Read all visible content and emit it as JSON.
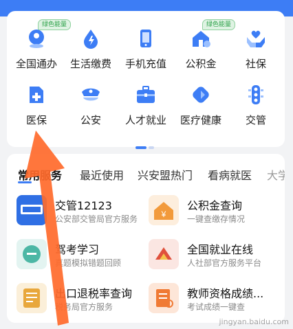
{
  "grid": {
    "items": [
      {
        "label": "全国通办",
        "badge": "绿色能量",
        "icon": "globe-pin-icon"
      },
      {
        "label": "生活缴费",
        "badge": "",
        "icon": "utility-drop-icon"
      },
      {
        "label": "手机充值",
        "badge": "",
        "icon": "phone-icon"
      },
      {
        "label": "公积金",
        "badge": "绿色能量",
        "icon": "fund-house-icon"
      },
      {
        "label": "社保",
        "badge": "",
        "icon": "hands-heart-icon"
      },
      {
        "label": "医保",
        "badge": "",
        "icon": "medical-insurance-icon"
      },
      {
        "label": "公安",
        "badge": "",
        "icon": "police-cap-icon"
      },
      {
        "label": "人才就业",
        "badge": "",
        "icon": "briefcase-icon"
      },
      {
        "label": "医疗健康",
        "badge": "",
        "icon": "heart-health-icon"
      },
      {
        "label": "交管",
        "badge": "",
        "icon": "traffic-light-icon"
      }
    ]
  },
  "tabs": [
    "常用服务",
    "最近使用",
    "兴安盟热门",
    "看病就医",
    "大学"
  ],
  "services": [
    {
      "title": "交管12123",
      "subtitle": "公安部交管局官方服务",
      "icon": "traffic-12123-icon",
      "color": "#2f6fe4"
    },
    {
      "title": "公积金查询",
      "subtitle": "一键查缴存情况",
      "icon": "house-yuan-icon",
      "color": "#f29a3b"
    },
    {
      "title": "驾考学习",
      "subtitle": "真题模拟错题回顾",
      "icon": "exam-icon",
      "color": "#4cb7a5"
    },
    {
      "title": "全国就业在线",
      "subtitle": "人社部官方服务平台",
      "icon": "employment-icon",
      "color": "#e0503c"
    },
    {
      "title": "出口退税率查询",
      "subtitle": "税务局官方服务",
      "icon": "tax-icon",
      "color": "#e8a73c"
    },
    {
      "title": "教师资格成绩...",
      "subtitle": "考试成绩一键查",
      "icon": "teacher-cert-icon",
      "color": "#f07a34"
    }
  ],
  "colors": {
    "primary": "#3d7df5",
    "arrow": "#ff6a2b",
    "badge_green": "#2fa24b"
  },
  "watermark": "jingyan.baidu.com"
}
